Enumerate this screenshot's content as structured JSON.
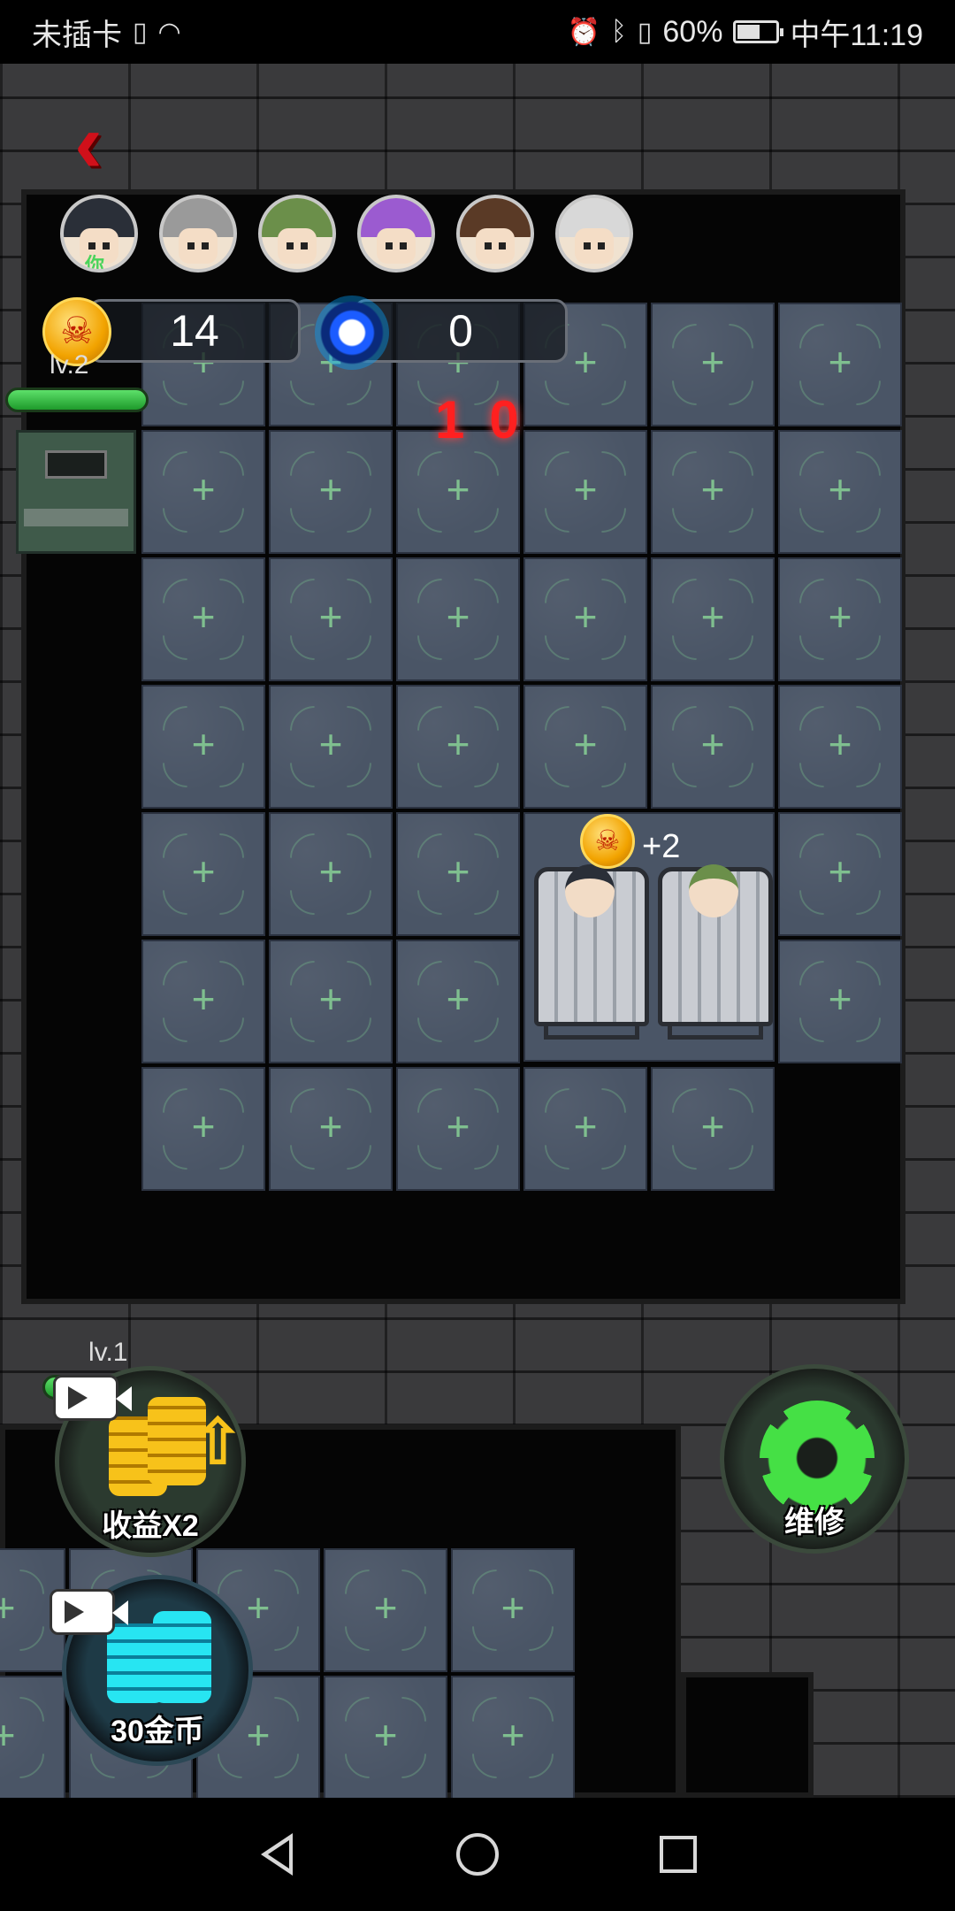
{
  "status_bar": {
    "carrier": "未插卡",
    "battery_percent": "60%",
    "time": "中午11:19",
    "battery_level": 0.6
  },
  "game": {
    "back_icon": "chevron-left-icon",
    "avatars": [
      {
        "name": "player",
        "tag": "你",
        "hair_color": "#2a2f38"
      },
      {
        "name": "grandma",
        "hair_color": "#9a9a9a"
      },
      {
        "name": "green-hair",
        "hair_color": "#6b8f4a"
      },
      {
        "name": "purple-girl",
        "hair_color": "#9b5bd0"
      },
      {
        "name": "brown-hair",
        "hair_color": "#5a3a26"
      },
      {
        "name": "old-man",
        "hair_color": "#d8d8d8"
      }
    ],
    "skull_coins": "14",
    "portal_energy": "0",
    "door_level": "lv.2",
    "door_hp_fraction": 1.0,
    "countdown": "10",
    "bed_gain": "+2",
    "lower_level": "lv.1",
    "income_button_label": "收益X2",
    "coins_button_label": "30金币",
    "repair_button_label": "维修",
    "colors": {
      "back": "#d0101a",
      "countdown": "#ff2020",
      "repair_accent": "#45e045",
      "coin_gold": "#f2a300",
      "coin_cyan": "#27e5f2"
    }
  }
}
